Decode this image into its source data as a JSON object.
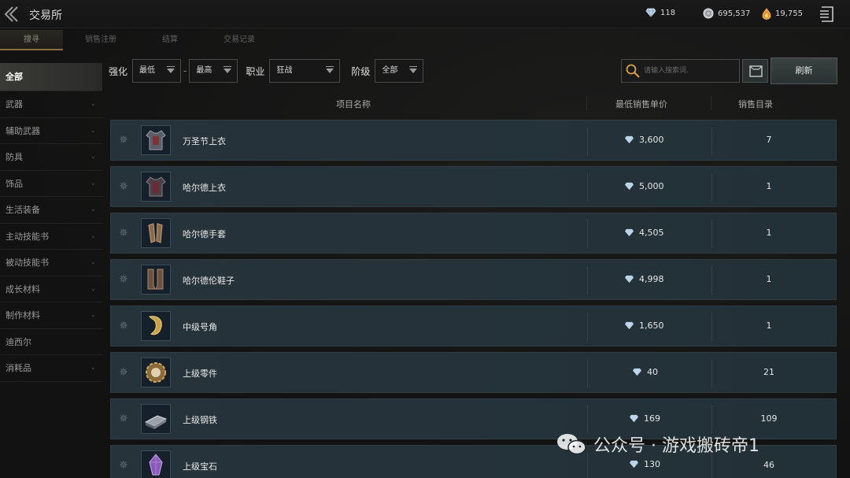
{
  "window": {
    "title": "交易所"
  },
  "currencies": {
    "blue_crystal": "118",
    "silver": "695,537",
    "gold": "19,755"
  },
  "tabs": [
    {
      "label": "搜寻",
      "active": true
    },
    {
      "label": "销售注册",
      "active": false
    },
    {
      "label": "结算",
      "active": false
    },
    {
      "label": "交易记录",
      "active": false
    }
  ],
  "sidebar": {
    "items": [
      {
        "label": "全部",
        "active": true,
        "has_chevron": false
      },
      {
        "label": "武器",
        "has_chevron": true
      },
      {
        "label": "辅助武器",
        "has_chevron": true
      },
      {
        "label": "防具",
        "has_chevron": true
      },
      {
        "label": "饰品",
        "has_chevron": true
      },
      {
        "label": "生活装备",
        "has_chevron": true
      },
      {
        "label": "主动技能书",
        "has_chevron": true
      },
      {
        "label": "被动技能书",
        "has_chevron": true
      },
      {
        "label": "成长材料",
        "has_chevron": true
      },
      {
        "label": "制作材料",
        "has_chevron": true
      },
      {
        "label": "迪西尔",
        "has_chevron": false
      },
      {
        "label": "消耗品",
        "has_chevron": true
      }
    ]
  },
  "filters": {
    "enhance_label": "强化",
    "enhance_min": "最低",
    "enhance_separator": "-",
    "enhance_max": "最高",
    "class_label": "职业",
    "class_value": "狂战",
    "tier_label": "阶级",
    "tier_value": "全部"
  },
  "search": {
    "placeholder": "请输入搜索词."
  },
  "refresh_label": "刷新",
  "table": {
    "headers": {
      "name": "项目名称",
      "price": "最低销售单价",
      "listing": "销售目录"
    },
    "rows": [
      {
        "name": "万圣节上衣",
        "price": "3,600",
        "listing": "7",
        "icon": "armor-top-icon"
      },
      {
        "name": "哈尔德上衣",
        "price": "5,000",
        "listing": "1",
        "icon": "armor-top-icon"
      },
      {
        "name": "哈尔德手套",
        "price": "4,505",
        "listing": "1",
        "icon": "gloves-icon"
      },
      {
        "name": "哈尔德伦鞋子",
        "price": "4,998",
        "listing": "1",
        "icon": "boots-icon"
      },
      {
        "name": "中级号角",
        "price": "1,650",
        "listing": "1",
        "icon": "horn-icon"
      },
      {
        "name": "上级零件",
        "price": "40",
        "listing": "21",
        "icon": "gear-part-icon"
      },
      {
        "name": "上级钢铁",
        "price": "169",
        "listing": "109",
        "icon": "steel-ingot-icon"
      },
      {
        "name": "上级宝石",
        "price": "130",
        "listing": "46",
        "icon": "gem-icon"
      }
    ]
  },
  "watermark": "公众号 · 游戏搬砖帝1",
  "colors": {
    "accent": "#8a6d3b",
    "row_bg": "#27333a",
    "gold": "#e3902a"
  }
}
